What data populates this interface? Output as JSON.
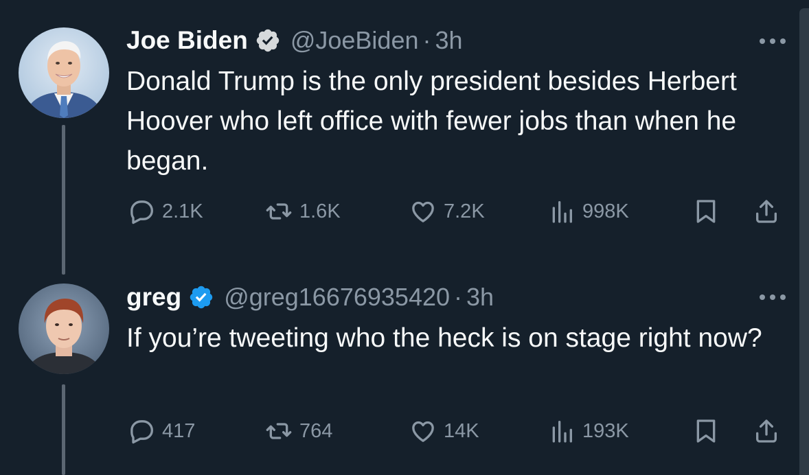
{
  "colors": {
    "background": "#15202b",
    "secondary_text": "#8b98a5",
    "verified": "#1d9bf0"
  },
  "tweets": [
    {
      "name": "Joe Biden",
      "handle": "@JoeBiden",
      "separator": "·",
      "time": "3h",
      "text": "Donald Trump is the only president besides Herbert Hoover who left office with fewer jobs than when he began.",
      "replies": "2.1K",
      "retweets": "1.6K",
      "likes": "7.2K",
      "views": "998K"
    },
    {
      "name": "greg",
      "handle": "@greg16676935420",
      "separator": "·",
      "time": "3h",
      "text": "If you’re tweeting who the heck is on stage right now?",
      "replies": "417",
      "retweets": "764",
      "likes": "14K",
      "views": "193K"
    }
  ]
}
